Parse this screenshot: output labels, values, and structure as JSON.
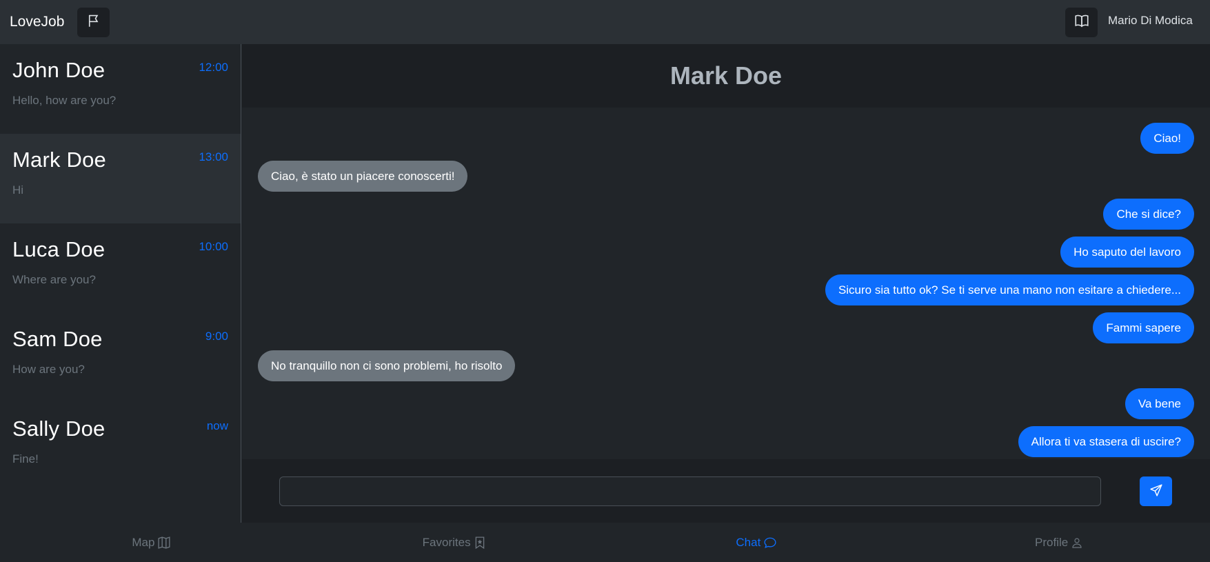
{
  "app": {
    "brand": "LoveJob"
  },
  "header": {
    "flag_icon": "flag-icon",
    "book_icon": "book-icon",
    "username": "Mario Di Modica"
  },
  "sidebar": {
    "contacts": [
      {
        "name": "John Doe",
        "time": "12:00",
        "preview": "Hello, how are you?",
        "active": false
      },
      {
        "name": "Mark Doe",
        "time": "13:00",
        "preview": "Hi",
        "active": true
      },
      {
        "name": "Luca Doe",
        "time": "10:00",
        "preview": "Where are you?",
        "active": false
      },
      {
        "name": "Sam Doe",
        "time": "9:00",
        "preview": "How are you?",
        "active": false
      },
      {
        "name": "Sally Doe",
        "time": "now",
        "preview": "Fine!",
        "active": false
      }
    ]
  },
  "chat": {
    "title": "Mark Doe",
    "messages": [
      {
        "from": "me",
        "text": "Ciao!"
      },
      {
        "from": "them",
        "text": "Ciao, è stato un piacere conoscerti!"
      },
      {
        "from": "me",
        "text": "Che si dice?"
      },
      {
        "from": "me",
        "text": "Ho saputo del lavoro"
      },
      {
        "from": "me",
        "text": "Sicuro sia tutto ok? Se ti serve una mano non esitare a chiedere..."
      },
      {
        "from": "me",
        "text": "Fammi sapere"
      },
      {
        "from": "them",
        "text": "No tranquillo non ci sono problemi, ho risolto"
      },
      {
        "from": "me",
        "text": "Va bene"
      },
      {
        "from": "me",
        "text": "Allora ti va stasera di uscire?"
      }
    ],
    "composer": {
      "value": "",
      "placeholder": ""
    },
    "send_icon": "send-icon"
  },
  "bottomnav": {
    "items": [
      {
        "label": "Map",
        "icon": "map-icon",
        "active": false
      },
      {
        "label": "Favorites",
        "icon": "bookmark-icon",
        "active": false
      },
      {
        "label": "Chat",
        "icon": "chat-icon",
        "active": true
      },
      {
        "label": "Profile",
        "icon": "person-icon",
        "active": false
      }
    ]
  },
  "colors": {
    "accent": "#0d6efd",
    "sent_bubble": "#0d6efd",
    "received_bubble": "#6c757d",
    "background": "#212529"
  }
}
